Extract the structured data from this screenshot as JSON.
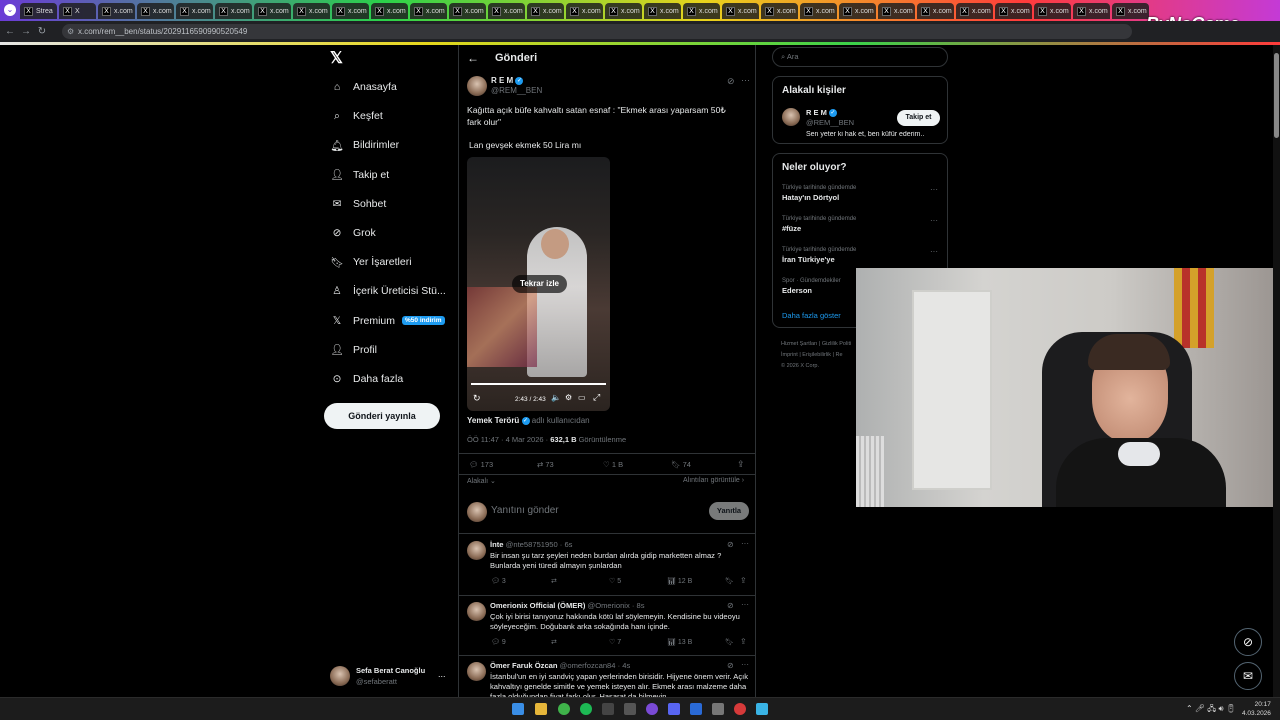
{
  "browser": {
    "tabs": [
      "Strea",
      "X",
      "x.com",
      "x.com",
      "x.com",
      "x.com",
      "x.com",
      "x.com",
      "x.com",
      "x.com",
      "x.com",
      "x.com",
      "x.com",
      "x.com",
      "x.com",
      "x.com",
      "x.com",
      "x.com",
      "x.com",
      "x.com",
      "x.com",
      "x.com",
      "x.com",
      "x.com",
      "x.com",
      "x.com",
      "x.com",
      "x.com",
      "x.com"
    ],
    "url": "x.com/rem__ben/status/2029116590990520549",
    "watermark": "ByNoGame"
  },
  "sidebar": {
    "items": [
      {
        "label": "Anasayfa",
        "icon": "home-icon"
      },
      {
        "label": "Keşfet",
        "icon": "search-icon"
      },
      {
        "label": "Bildirimler",
        "icon": "bell-icon"
      },
      {
        "label": "Takip et",
        "icon": "person-plus-icon"
      },
      {
        "label": "Sohbet",
        "icon": "mail-icon"
      },
      {
        "label": "Grok",
        "icon": "grok-icon"
      },
      {
        "label": "Yer İşaretleri",
        "icon": "bookmark-icon"
      },
      {
        "label": "İçerik Üreticisi Stü...",
        "icon": "creator-icon"
      },
      {
        "label": "Premium",
        "icon": "x-logo-icon",
        "badge": "%50 indirim"
      },
      {
        "label": "Profil",
        "icon": "profile-icon"
      },
      {
        "label": "Daha fazla",
        "icon": "more-circle-icon"
      }
    ],
    "post_button": "Gönderi yayınla",
    "user": {
      "name": "Sefa Berat Canoğlu",
      "handle": "@sefaberatt",
      "more": "..."
    }
  },
  "post": {
    "header": "Gönderi",
    "author": {
      "name": "R E M",
      "handle": "@REM__BEN"
    },
    "text1": "Kağıtta açık büfe kahvaltı satan esnaf :  \"Ekmek arası yaparsam 50₺ fark olur\"",
    "text2": "Lan gevşek ekmek 50 Lira mı",
    "video": {
      "overlay": "Tekrar izle",
      "time": "2:43 / 2:43",
      "progress": 1.0
    },
    "source": {
      "name": "Yemek Terörü",
      "suffix": "adlı kullanıcıdan"
    },
    "meta": {
      "time": "ÖÖ 11:47 · 4 Mar 2026 · ",
      "views": "632,1 B",
      "views_label": " Görüntülenme"
    },
    "stats": {
      "replies": "173",
      "reposts": "73",
      "likes": "1 B",
      "bookmarks": "74"
    },
    "sort_label": "Alakalı",
    "quotes_label": "Alıntıları görüntüle",
    "reply_placeholder": "Yanıtını gönder",
    "reply_button": "Yanıtla"
  },
  "replies": [
    {
      "name": "İnte",
      "handle": "@nte58751950 · 6s",
      "text": "Bir insan şu tarz şeyleri neden burdan alırda gidip marketten almaz ?  Bunlarda yeni türedi almayın şunlardan",
      "replies": "3",
      "reposts": "",
      "likes": "5",
      "views": "12 B"
    },
    {
      "name": "Omerionix Official (ÖMER)",
      "handle": "@Omerionix · 8s",
      "text": "Çok iyi birisi tanıyoruz hakkında kötü laf söylemeyin. Kendisine bu videoyu söyleyeceğim. Doğubank arka sokağında hanı içinde.",
      "replies": "9",
      "reposts": "",
      "likes": "7",
      "views": "13 B"
    },
    {
      "name": "Ömer Faruk Özcan",
      "handle": "@omerfozcan84 · 4s",
      "text": "İstanbul'un en iyi sandviç yapan yerlerinden birisidir. Hijyene önem verir. Açık kahvaltıyı genelde simitle ve yemek isteyen alır. Ekmek arası malzeme daha fazla olduğundan fiyat farkı olur. Haşarat da bilmeyin.",
      "replies": "",
      "reposts": "",
      "likes": "",
      "views": ""
    }
  ],
  "right": {
    "search_placeholder": "Ara",
    "relevant": {
      "title": "Alakalı kişiler",
      "name": "R E M",
      "handle": "@REM__BEN",
      "bio": "Sen yeter ki hak et, ben küfür ederim..",
      "follow": "Takip et"
    },
    "trends": {
      "title": "Neler oluyor?",
      "items": [
        {
          "context": "Türkiye tarihinde gündemde",
          "name": "Hatay'ın Dörtyol"
        },
        {
          "context": "Türkiye tarihinde gündemde",
          "name": "#füze"
        },
        {
          "context": "Türkiye tarihinde gündemde",
          "name": "İran Türkiye'ye"
        },
        {
          "context": "Spor · Gündemdekiler",
          "name": "Ederson"
        }
      ],
      "more": "Daha fazla göster"
    },
    "footer1": "Hizmet Şartları  |  Gizlilik Politi",
    "footer2": "İmprint  |  Erişilebilirlik  |  Re",
    "footer3": "© 2026 X Corp."
  },
  "taskbar": {
    "time": "20:17",
    "date": "4.03.2026"
  },
  "colors": {
    "accent": "#1d9bf0",
    "bg": "#000000",
    "border": "#2f3336",
    "muted": "#71767b"
  }
}
